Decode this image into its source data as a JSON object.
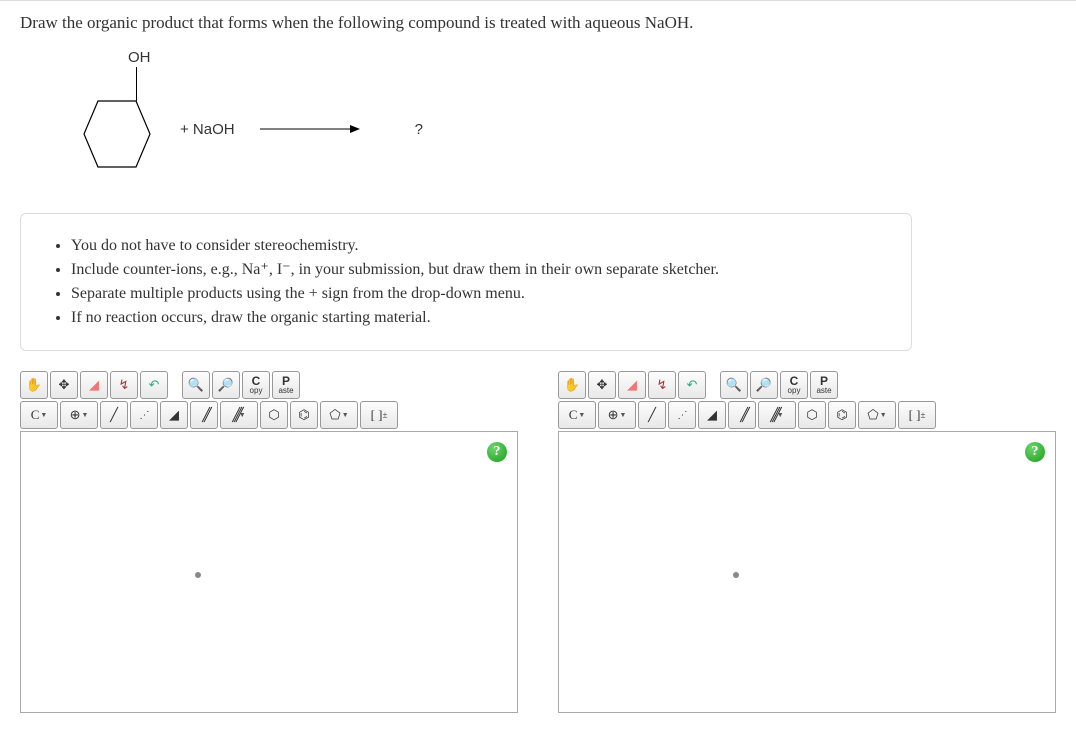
{
  "question": "Draw the organic product that forms when the following compound is treated with aqueous NaOH.",
  "reaction": {
    "oh_label": "OH",
    "reagent": "+  NaOH",
    "product": "?"
  },
  "hints": [
    "You do not have to consider stereochemistry.",
    "Include counter-ions, e.g., Na⁺, I⁻, in your submission, but draw them in their own separate sketcher.",
    "Separate multiple products using the + sign from the drop-down menu.",
    "If no reaction occurs, draw the organic starting material."
  ],
  "toolbar": {
    "copy_top": "C",
    "copy_bottom": "opy",
    "paste_top": "P",
    "paste_bottom": "aste",
    "element": "C",
    "charge": "[ ]"
  },
  "help": "?"
}
